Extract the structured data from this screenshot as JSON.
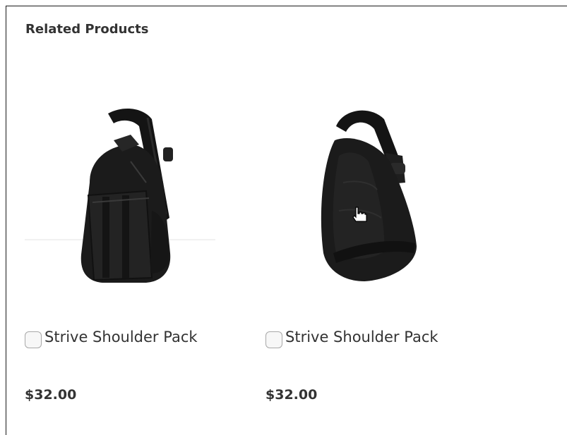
{
  "block": {
    "title": "Related Products"
  },
  "products": [
    {
      "name": "Strive Shoulder Pack",
      "price": "$32.00",
      "checked": false,
      "image_icon": "sling-backpack-front"
    },
    {
      "name": "Strive Shoulder Pack",
      "price": "$32.00",
      "checked": false,
      "image_icon": "sling-backpack-back"
    }
  ],
  "colors": {
    "text": "#333333",
    "bag": "#1b1b1b",
    "checkbox_border": "#a8a8a8"
  },
  "cursor_icon": "hand-pointer-icon"
}
